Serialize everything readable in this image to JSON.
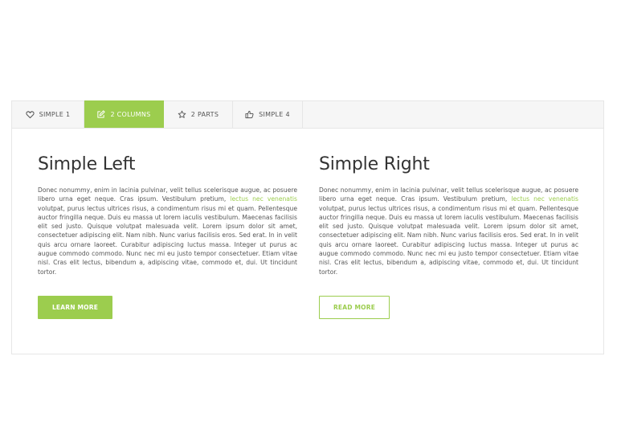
{
  "tabs": [
    {
      "label": "SIMPLE 1",
      "icon": "heart-icon",
      "active": false
    },
    {
      "label": "2 COLUMNS",
      "icon": "edit-icon",
      "active": true
    },
    {
      "label": "2 PARTS",
      "icon": "star-icon",
      "active": false
    },
    {
      "label": "SIMPLE 4",
      "icon": "thumbs-up-icon",
      "active": false
    }
  ],
  "colors": {
    "accent": "#9ccd4e",
    "text": "#555555",
    "heading": "#333333",
    "tab_bar_bg": "#f6f6f6",
    "border": "#e6e6e6"
  },
  "left": {
    "title": "Simple Left",
    "text_before_link": "Donec nonummy, enim in lacinia pulvinar, velit tellus scelerisque augue, ac posuere libero urna eget neque. Cras ipsum. Vestibulum pretium, ",
    "link": "lectus nec venenatis",
    "text_after_link": " volutpat, purus lectus ultrices risus, a condimentum risus mi et quam. Pellentesque auctor fringilla neque. Duis eu massa ut lorem iaculis vestibulum. Maecenas facilisis elit sed justo. Quisque volutpat malesuada velit. Lorem ipsum dolor sit amet, consectetuer adipiscing elit. Nam nibh. Nunc varius facilisis eros. Sed erat. In in velit quis arcu ornare laoreet. Curabitur adipiscing luctus massa. Integer ut purus ac augue commodo commodo. Nunc nec mi eu justo tempor consectetuer. Etiam vitae nisl. Cras elit lectus, bibendum a, adipiscing vitae, commodo et, dui. Ut tincidunt tortor.",
    "button": "LEARN MORE"
  },
  "right": {
    "title": "Simple Right",
    "text_before_link": "Donec nonummy, enim in lacinia pulvinar, velit tellus scelerisque augue, ac posuere libero urna eget neque. Cras ipsum. Vestibulum pretium, ",
    "link": "lectus nec venenatis",
    "text_after_link": " volutpat, purus lectus ultrices risus, a condimentum risus mi et quam. Pellentesque auctor fringilla neque. Duis eu massa ut lorem iaculis vestibulum. Maecenas facilisis elit sed justo. Quisque volutpat malesuada velit. Lorem ipsum dolor sit amet, consectetuer adipiscing elit. Nam nibh. Nunc varius facilisis eros. Sed erat. In in velit quis arcu ornare laoreet. Curabitur adipiscing luctus massa. Integer ut purus ac augue commodo commodo. Nunc nec mi eu justo tempor consectetuer. Etiam vitae nisl. Cras elit lectus, bibendum a, adipiscing vitae, commodo et, dui. Ut tincidunt tortor.",
    "button": "READ MORE"
  }
}
